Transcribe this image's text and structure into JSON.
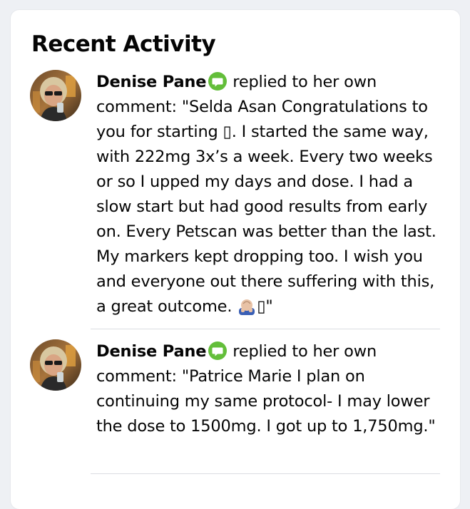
{
  "card": {
    "title": "Recent Activity"
  },
  "activities": [
    {
      "author": "Denise Pane",
      "badge_icon": "speech-bubble-icon",
      "action": "replied to her own comment:",
      "comment_before_emoji": "\"Selda Asan Congratulations to you for starting ▯. I started the same way, with 222mg 3x’s a week. Every two weeks or so I upped my days and dose. I had a slow start but had good results from early on. Every Petscan was better than the last. My markers kept dropping too. I wish you and everyone out there suffering with this, a great outcome.",
      "emoji_icon": "person-bowing-icon",
      "comment_after_emoji": "▯\""
    },
    {
      "author": "Denise Pane",
      "badge_icon": "speech-bubble-icon",
      "action": "replied to her own comment:",
      "comment": "\"Patrice Marie I plan on continuing my same protocol- I may lower the dose to 1500mg. I got up to 1,750mg.\""
    }
  ],
  "colors": {
    "page_background": "#eef0f4",
    "card_background": "#ffffff",
    "text": "#050505",
    "badge_green": "#63be3a",
    "separator": "#dadde1"
  }
}
